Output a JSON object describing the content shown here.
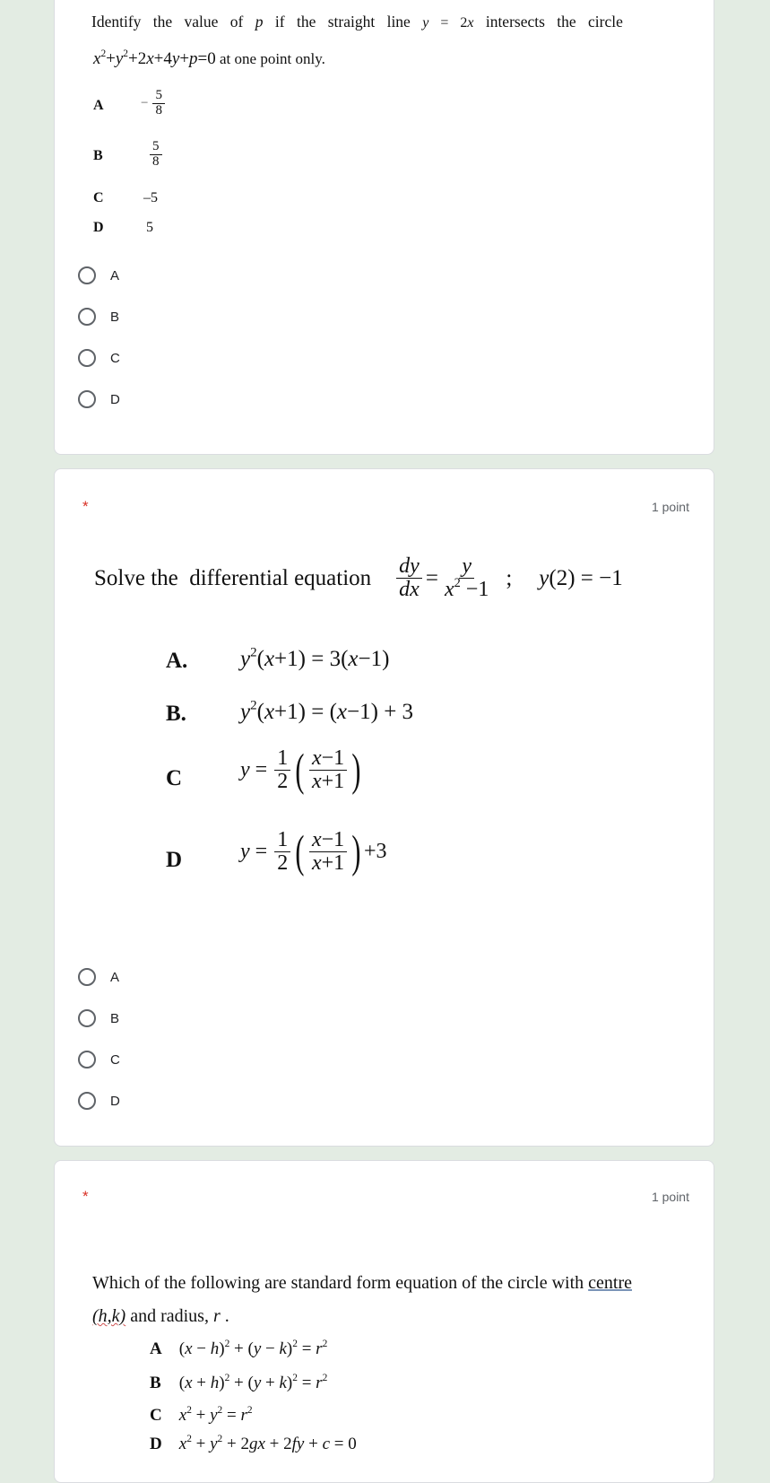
{
  "colors": {
    "page_background": "#e3ece3",
    "card_background": "#ffffff",
    "required_asterisk": "#d93025",
    "radio_border": "#5f6368"
  },
  "questions": [
    {
      "stem_text_1": "Identify the value of",
      "stem_var_p": "p",
      "stem_text_2": "if the straight line",
      "stem_line_eq": "y = 2x",
      "stem_text_3": "intersects the circle",
      "stem_circle_eq": "x² + y² + 2x + 4y + p = 0",
      "stem_text_4": "at one point only.",
      "image_options": [
        {
          "letter": "A",
          "value": "−5/8",
          "sign": "−",
          "num": "5",
          "den": "8"
        },
        {
          "letter": "B",
          "value": "5/8",
          "num": "5",
          "den": "8"
        },
        {
          "letter": "C",
          "value": "–5"
        },
        {
          "letter": "D",
          "value": "5"
        }
      ],
      "choices": [
        "A",
        "B",
        "C",
        "D"
      ],
      "selected": null
    },
    {
      "required_mark": "*",
      "points": "1 point",
      "stem_text": "Solve the  differential equation",
      "stem_equation": "dy/dx = y/(x² − 1) ; y(2) = −1",
      "stem_initial_condition": "y(2) = −1",
      "image_options": [
        {
          "letter": "A.",
          "value": "y²(x+1) = 3(x−1)"
        },
        {
          "letter": "B.",
          "value": "y²(x+1) = (x−1)+3"
        },
        {
          "letter": "C",
          "value": "y = 1/2 ((x−1)/(x+1))"
        },
        {
          "letter": "D",
          "value": "y = 1/2 ((x−1)/(x+1)) + 3"
        }
      ],
      "choices": [
        "A",
        "B",
        "C",
        "D"
      ],
      "selected": null
    },
    {
      "required_mark": "*",
      "points": "1 point",
      "stem_text_1": "Which of the following are standard form equation of the circle with",
      "stem_underlined": "centre",
      "stem_hk": "(h,k)",
      "stem_text_2": "and radius,",
      "stem_r": "r",
      "stem_end": ".",
      "image_options": [
        {
          "letter": "A",
          "value": "(x−h)² + (y−k)² = r²"
        },
        {
          "letter": "B",
          "value": "(x+h)² + (y+k)² = r²"
        },
        {
          "letter": "C",
          "value": "x² + y² = r²"
        },
        {
          "letter": "D",
          "value": "x² + y² + 2gx + 2fy + c = 0"
        }
      ]
    }
  ]
}
